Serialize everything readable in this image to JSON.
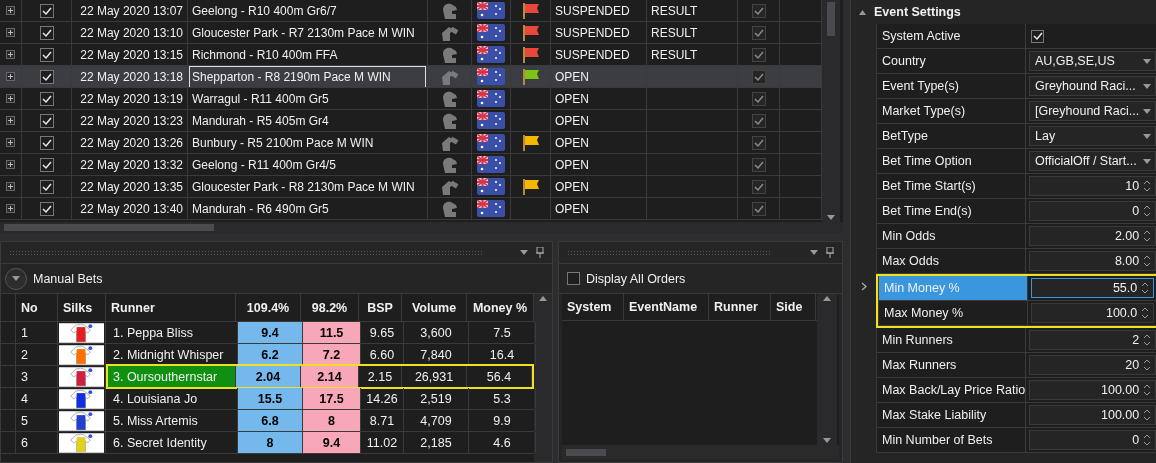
{
  "events": [
    {
      "checked": true,
      "time": "22 May 2020 13:07",
      "name": "Geelong - R10 400m Gr6/7",
      "kind": "greyhound",
      "color": "#e8483a",
      "status": "SUSPENDED",
      "result": "RESULT",
      "settled": true,
      "selected": false
    },
    {
      "checked": true,
      "time": "22 May 2020 13:10",
      "name": "Gloucester Park - R7 2130m Pace M WIN",
      "kind": "harness",
      "color": "#e8483a",
      "status": "SUSPENDED",
      "result": "RESULT",
      "settled": true,
      "selected": false
    },
    {
      "checked": true,
      "time": "22 May 2020 13:15",
      "name": "Richmond - R10 400m FFA",
      "kind": "greyhound",
      "color": "#e8483a",
      "status": "SUSPENDED",
      "result": "RESULT",
      "settled": true,
      "selected": false
    },
    {
      "checked": true,
      "time": "22 May 2020 13:18",
      "name": "Shepparton - R8 2190m Pace M WIN",
      "kind": "harness",
      "color": "#7cc416",
      "status": "OPEN",
      "settled": true,
      "selected": true
    },
    {
      "checked": true,
      "time": "22 May 2020 13:19",
      "name": "Warragul - R11 400m Gr5",
      "kind": "greyhound",
      "status": "OPEN",
      "settled": true,
      "selected": false
    },
    {
      "checked": true,
      "time": "22 May 2020 13:23",
      "name": "Mandurah - R5 405m Gr4",
      "kind": "greyhound",
      "status": "OPEN",
      "settled": true,
      "selected": false
    },
    {
      "checked": true,
      "time": "22 May 2020 13:26",
      "name": "Bunbury - R5 2100m Pace M WIN",
      "kind": "harness",
      "color": "#f5b800",
      "status": "OPEN",
      "settled": true,
      "selected": false
    },
    {
      "checked": true,
      "time": "22 May 2020 13:32",
      "name": "Geelong - R11 400m Gr4/5",
      "kind": "greyhound",
      "status": "OPEN",
      "settled": true,
      "selected": false
    },
    {
      "checked": true,
      "time": "22 May 2020 13:35",
      "name": "Gloucester Park - R8 2130m Pace M WIN",
      "kind": "harness",
      "color": "#f5b800",
      "status": "OPEN",
      "settled": true,
      "selected": false
    },
    {
      "checked": true,
      "time": "22 May 2020 13:40",
      "name": "Mandurah - R6 490m Gr5",
      "kind": "greyhound",
      "status": "OPEN",
      "settled": true,
      "selected": false
    }
  ],
  "manual_bets": {
    "title": "Manual Bets",
    "columns": [
      "No",
      "Silks",
      "Runner",
      "109.4%",
      "98.2%",
      "BSP",
      "Volume",
      "Money %"
    ],
    "runners": [
      {
        "no": "1",
        "color": "#e02020",
        "name": "1. Peppa Bliss",
        "back": "9.4",
        "lay": "11.5",
        "bsp": "9.65",
        "volume": "3,600",
        "money": "7.5",
        "selected": false,
        "highlighted": false
      },
      {
        "no": "2",
        "color": "#ff7000",
        "name": "2. Midnight Whisper",
        "back": "6.2",
        "lay": "7.2",
        "bsp": "6.60",
        "volume": "7,840",
        "money": "16.4",
        "selected": false,
        "highlighted": false
      },
      {
        "no": "3",
        "color": "#d02040",
        "name": "3. Oursouthernstar",
        "back": "2.04",
        "lay": "2.14",
        "bsp": "2.15",
        "volume": "26,931",
        "money": "56.4",
        "selected": true,
        "highlighted": true
      },
      {
        "no": "4",
        "color": "#1030e0",
        "name": "4. Louisiana Jo",
        "back": "15.5",
        "lay": "17.5",
        "bsp": "14.26",
        "volume": "2,519",
        "money": "5.3",
        "selected": false,
        "highlighted": false
      },
      {
        "no": "5",
        "color": "#2040d0",
        "name": "5. Miss Artemis",
        "back": "6.8",
        "lay": "8",
        "bsp": "8.71",
        "volume": "4,709",
        "money": "9.9",
        "selected": false,
        "highlighted": false
      },
      {
        "no": "6",
        "color": "#e0d020",
        "name": "6. Secret Identity",
        "back": "8",
        "lay": "9.4",
        "bsp": "11.02",
        "volume": "2,185",
        "money": "4.6",
        "selected": false,
        "highlighted": false
      }
    ]
  },
  "orders": {
    "display_all": {
      "label": "Display All Orders",
      "checked": false
    },
    "columns": [
      "System",
      "EventName",
      "Runner",
      "Side"
    ]
  },
  "settings": {
    "title": "Event Settings",
    "expanded": true,
    "rows": [
      {
        "label": "System Active",
        "kind": "check",
        "checked": true,
        "selected": false,
        "highlighted": false
      },
      {
        "label": "Country",
        "kind": "dropdown",
        "value": "AU,GB,SE,US",
        "selected": false,
        "highlighted": false
      },
      {
        "label": "Event Type(s)",
        "kind": "dropdown",
        "value": "Greyhound Raci...",
        "selected": false,
        "highlighted": false
      },
      {
        "label": "Market Type(s)",
        "kind": "dropdown",
        "value": "[Greyhound Raci...",
        "selected": false,
        "highlighted": false
      },
      {
        "label": "BetType",
        "kind": "dropdown",
        "value": "Lay",
        "selected": false,
        "highlighted": false
      },
      {
        "label": "Bet Time Option",
        "kind": "dropdown",
        "value": "OfficialOff / Start...",
        "selected": false,
        "highlighted": false
      },
      {
        "label": "Bet Time Start(s)",
        "kind": "spin",
        "value": "10",
        "selected": false,
        "highlighted": false
      },
      {
        "label": "Bet Time End(s)",
        "kind": "spin",
        "value": "0",
        "selected": false,
        "highlighted": false
      },
      {
        "label": "Min Odds",
        "kind": "spin",
        "value": "2.00",
        "selected": false,
        "highlighted": false
      },
      {
        "label": "Max Odds",
        "kind": "spin",
        "value": "8.00",
        "selected": false,
        "highlighted": false
      },
      {
        "label": "Min Money %",
        "kind": "spin",
        "value": "55.0",
        "selected": true,
        "highlighted": true
      },
      {
        "label": "Max Money %",
        "kind": "spin",
        "value": "100.0",
        "selected": false,
        "highlighted": true
      },
      {
        "label": "Min Runners",
        "kind": "spin",
        "value": "2",
        "selected": false,
        "highlighted": false
      },
      {
        "label": "Max Runners",
        "kind": "spin",
        "value": "20",
        "selected": false,
        "highlighted": false
      },
      {
        "label": "Max Back/Lay Price Ratio",
        "kind": "spin",
        "value": "100.00",
        "selected": false,
        "highlighted": false
      },
      {
        "label": "Max Stake Liability",
        "kind": "spin",
        "value": "100.00",
        "selected": false,
        "highlighted": false
      },
      {
        "label": "Min Number of Bets",
        "kind": "spin",
        "value": "0",
        "selected": false,
        "highlighted": false
      }
    ]
  }
}
